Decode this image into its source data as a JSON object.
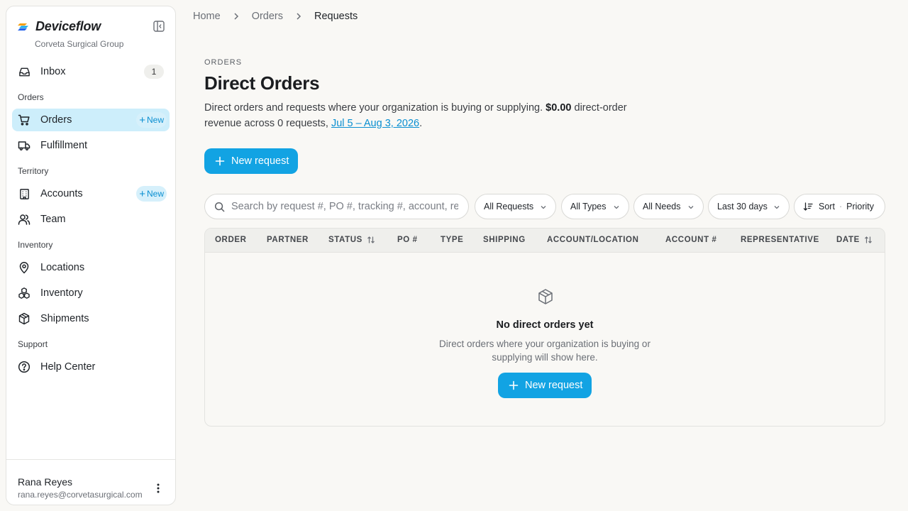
{
  "brand": {
    "name": "Deviceflow",
    "org": "Corveta Surgical Group"
  },
  "sidebar": {
    "inbox": {
      "label": "Inbox",
      "count": "1"
    },
    "sections": {
      "orders": "Orders",
      "territory": "Territory",
      "inventory": "Inventory",
      "support": "Support"
    },
    "items": {
      "orders": {
        "label": "Orders",
        "new": "New"
      },
      "fulfillment": {
        "label": "Fulfillment"
      },
      "accounts": {
        "label": "Accounts",
        "new": "New"
      },
      "team": {
        "label": "Team"
      },
      "locations": {
        "label": "Locations"
      },
      "inventory": {
        "label": "Inventory"
      },
      "shipments": {
        "label": "Shipments"
      },
      "help": {
        "label": "Help Center"
      }
    },
    "user": {
      "name": "Rana Reyes",
      "email": "rana.reyes@corvetasurgical.com"
    }
  },
  "breadcrumb": {
    "home": "Home",
    "orders": "Orders",
    "current": "Requests"
  },
  "header": {
    "eyebrow": "ORDERS",
    "title": "Direct Orders",
    "desc_prefix": "Direct orders and requests where your organization is buying or supplying.",
    "revenue": "$0.00",
    "desc_middle": "direct-order revenue across 0 requests,",
    "date_range": "Jul 5 – Aug 3, 2026",
    "desc_end": ".",
    "new_request": "New request"
  },
  "filters": {
    "search_placeholder": "Search by request #, PO #, tracking #, account, rep, or status",
    "requests": "All Requests",
    "types": "All Types",
    "needs": "All Needs",
    "period": "Last 30 days",
    "sort_label": "Sort",
    "sort_dot": "·",
    "sort_value": "Priority"
  },
  "table": {
    "columns": [
      "ORDER",
      "PARTNER",
      "STATUS",
      "PO #",
      "TYPE",
      "SHIPPING",
      "ACCOUNT/LOCATION",
      "ACCOUNT #",
      "REPRESENTATIVE",
      "DATE"
    ],
    "empty_title": "No direct orders yet",
    "empty_text": "Direct orders where your organization is buying or supplying will show here.",
    "empty_button": "New request"
  },
  "colors": {
    "accent": "#12a3e3",
    "active_bg": "#cdeefb",
    "page_bg": "#f9f8f5"
  }
}
